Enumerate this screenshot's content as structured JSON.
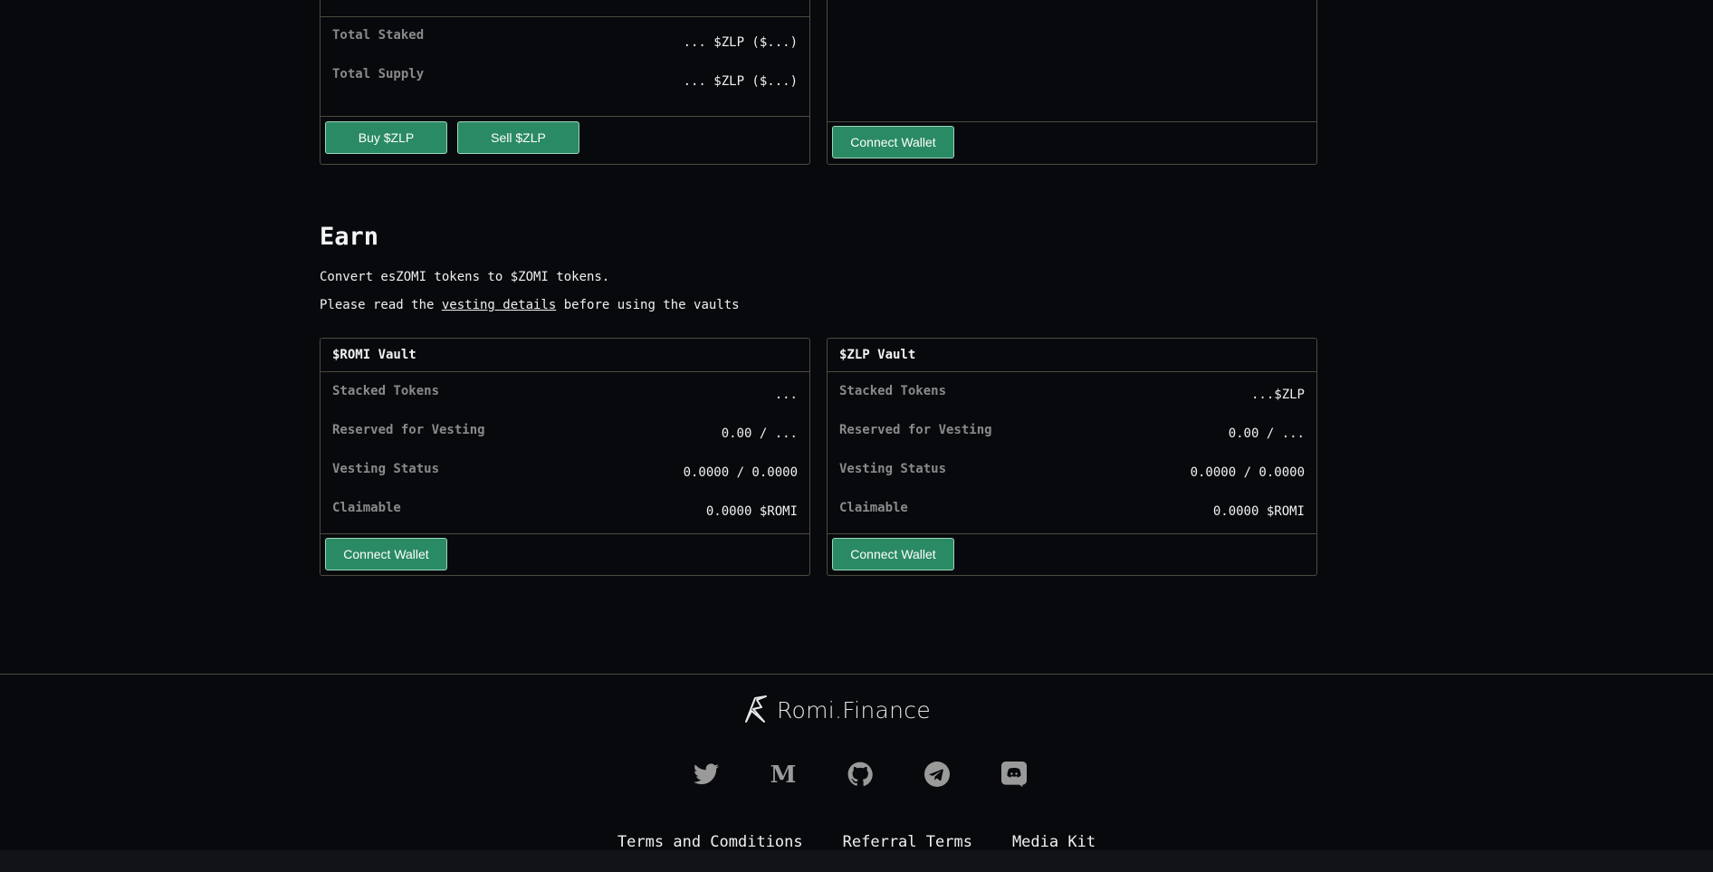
{
  "zlp_card": {
    "rows": [
      {
        "label": "Total Staked",
        "value": "... $ZLP ($...)"
      },
      {
        "label": "Total Supply",
        "value": "... $ZLP ($...)"
      }
    ],
    "buy_label": "Buy $ZLP",
    "sell_label": "Sell $ZLP"
  },
  "right_top_card": {
    "connect_label": "Connect Wallet"
  },
  "earn": {
    "title": "Earn",
    "line1": "Convert esZOMI tokens to $ZOMI tokens.",
    "line2_before": "Please read the ",
    "line2_link": "vesting details",
    "line2_after": " before using the vaults"
  },
  "vaults": [
    {
      "title": "$ROMI Vault",
      "rows": [
        {
          "label": "Stacked Tokens",
          "value": "..."
        },
        {
          "label": "Reserved for Vesting",
          "value": "0.00 / ..."
        },
        {
          "label": "Vesting Status",
          "value": "0.0000 / 0.0000"
        },
        {
          "label": "Claimable",
          "value": "0.0000 $ROMI"
        }
      ],
      "connect_label": "Connect Wallet"
    },
    {
      "title": "$ZLP Vault",
      "rows": [
        {
          "label": "Stacked Tokens",
          "value": "...$ZLP"
        },
        {
          "label": "Reserved for Vesting",
          "value": "0.00 / ..."
        },
        {
          "label": "Vesting Status",
          "value": "0.0000 / 0.0000"
        },
        {
          "label": "Claimable",
          "value": "0.0000 $ROMI"
        }
      ],
      "connect_label": "Connect Wallet"
    }
  ],
  "footer": {
    "brand": "Romi.Finance",
    "socials": [
      "twitter-icon",
      "medium-icon",
      "github-icon",
      "telegram-icon",
      "discord-icon"
    ],
    "links": [
      "Terms and Comditions",
      "Referral Terms",
      "Media Kit"
    ]
  },
  "colors": {
    "background": "#07090c",
    "accent": "#2a8a64",
    "border": "#4d4a3f",
    "muted_label": "#8a8a8a"
  }
}
